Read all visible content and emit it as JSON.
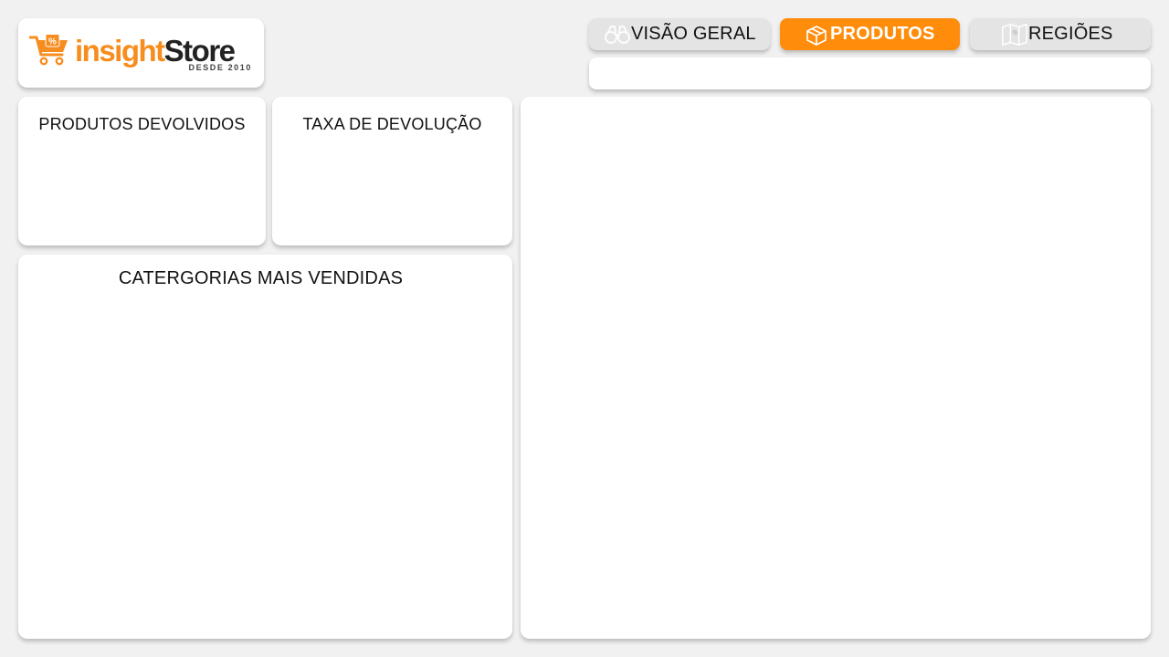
{
  "brand": {
    "name_part1": "insight",
    "name_part2": "Store",
    "since": "DESDE 2010",
    "accent_color": "#f78d1e"
  },
  "nav": {
    "tabs": [
      {
        "label": "VISÃO GERAL",
        "icon": "binoculars-icon",
        "active": false
      },
      {
        "label": "PRODUTOS",
        "icon": "box-icon",
        "active": true
      },
      {
        "label": "REGIÕES",
        "icon": "map-icon",
        "active": false
      }
    ],
    "active_color": "#ff8c0a"
  },
  "cards": {
    "devolvidos_title": "PRODUTOS DEVOLVIDOS",
    "taxa_title": "TAXA DE DEVOLUÇÃO",
    "categorias_title": "CATERGORIAS MAIS VENDIDAS"
  }
}
